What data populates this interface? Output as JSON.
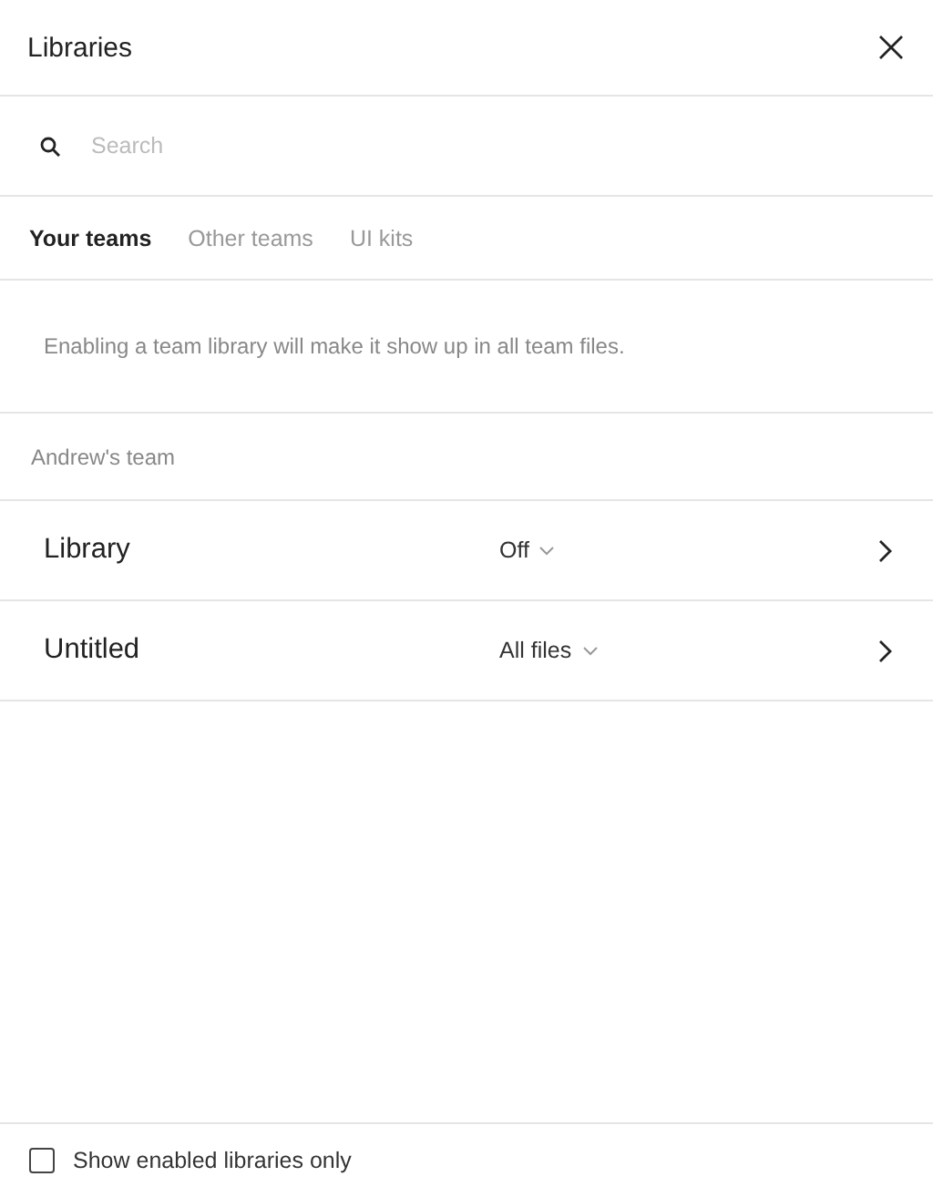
{
  "window": {
    "title": "Libraries"
  },
  "search": {
    "placeholder": "Search"
  },
  "tabs": [
    {
      "label": "Your teams",
      "selected": true
    },
    {
      "label": "Other teams",
      "selected": false
    },
    {
      "label": "UI kits",
      "selected": false
    }
  ],
  "info": "Enabling a team library will make it show up in all team files.",
  "team": {
    "name": "Andrew's team",
    "libraries": [
      {
        "name": "Library",
        "setting": "Off"
      },
      {
        "name": "Untitled",
        "setting": "All files"
      }
    ]
  },
  "footer": {
    "label": "Show enabled libraries only",
    "checked": false
  }
}
